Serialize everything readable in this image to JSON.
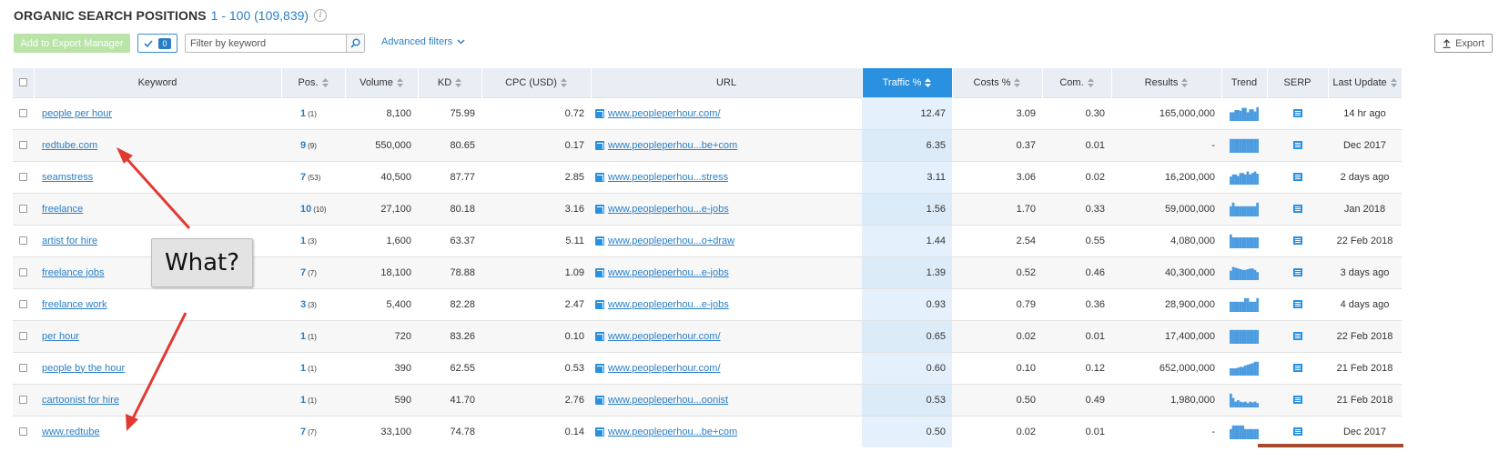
{
  "header": {
    "title": "ORGANIC SEARCH POSITIONS",
    "range": "1 - 100 (109,839)",
    "info_icon": "info-icon"
  },
  "toolbar": {
    "export_manager_label": "Add to Export Manager",
    "selected_count": "0",
    "filter_placeholder": "Filter by keyword",
    "filter_value": "",
    "advanced_filters_label": "Advanced filters",
    "export_label": "Export"
  },
  "columns": [
    {
      "key": "checkbox",
      "label": ""
    },
    {
      "key": "keyword",
      "label": "Keyword"
    },
    {
      "key": "pos",
      "label": "Pos."
    },
    {
      "key": "volume",
      "label": "Volume"
    },
    {
      "key": "kd",
      "label": "KD"
    },
    {
      "key": "cpc",
      "label": "CPC (USD)"
    },
    {
      "key": "url",
      "label": "URL"
    },
    {
      "key": "traffic",
      "label": "Traffic %"
    },
    {
      "key": "costs",
      "label": "Costs %"
    },
    {
      "key": "com",
      "label": "Com."
    },
    {
      "key": "results",
      "label": "Results"
    },
    {
      "key": "trend",
      "label": "Trend"
    },
    {
      "key": "serp",
      "label": "SERP"
    },
    {
      "key": "last_update",
      "label": "Last Update"
    }
  ],
  "active_sort_column": "traffic",
  "rows": [
    {
      "keyword": "people per hour",
      "pos": "1",
      "prev": "(1)",
      "volume": "8,100",
      "kd": "75.99",
      "cpc": "0.72",
      "url": "www.peopleperhour.com/",
      "traffic": "12.47",
      "costs": "3.09",
      "com": "0.30",
      "results": "165,000,000",
      "trend": [
        0.6,
        0.6,
        0.75,
        0.75,
        0.7,
        0.9,
        0.9,
        0.6,
        0.8,
        0.8,
        0.65,
        0.95
      ],
      "last_update": "14 hr ago"
    },
    {
      "keyword": "redtube.com",
      "pos": "9",
      "prev": "(9)",
      "volume": "550,000",
      "kd": "80.65",
      "cpc": "0.17",
      "url": "www.peopleperhou...be+com",
      "traffic": "6.35",
      "costs": "0.37",
      "com": "0.01",
      "results": "-",
      "trend": [
        0.95,
        0.95,
        0.95,
        0.95,
        0.95,
        0.95,
        0.95,
        0.95,
        0.95,
        0.95,
        0.95,
        0.95
      ],
      "last_update": "Dec 2017"
    },
    {
      "keyword": "seamstress",
      "pos": "7",
      "prev": "(53)",
      "volume": "40,500",
      "kd": "87.77",
      "cpc": "2.85",
      "url": "www.peopleperhou...stress",
      "traffic": "3.11",
      "costs": "3.06",
      "com": "0.02",
      "results": "16,200,000",
      "trend": [
        0.55,
        0.7,
        0.7,
        0.6,
        0.8,
        0.8,
        0.7,
        0.9,
        0.7,
        0.8,
        0.9,
        0.75
      ],
      "last_update": "2 days ago"
    },
    {
      "keyword": "freelance",
      "pos": "10",
      "prev": "(10)",
      "volume": "27,100",
      "kd": "80.18",
      "cpc": "3.16",
      "url": "www.peopleperhou...e-jobs",
      "traffic": "1.56",
      "costs": "1.70",
      "com": "0.33",
      "results": "59,000,000",
      "trend": [
        0.7,
        0.95,
        0.7,
        0.7,
        0.7,
        0.7,
        0.7,
        0.7,
        0.7,
        0.7,
        0.7,
        0.95
      ],
      "last_update": "Jan 2018"
    },
    {
      "keyword": "artist for hire",
      "pos": "1",
      "prev": "(3)",
      "volume": "1,600",
      "kd": "63.37",
      "cpc": "5.11",
      "url": "www.peopleperhou...o+draw",
      "traffic": "1.44",
      "costs": "2.54",
      "com": "0.55",
      "results": "4,080,000",
      "trend": [
        0.95,
        0.75,
        0.75,
        0.75,
        0.75,
        0.75,
        0.75,
        0.75,
        0.75,
        0.75,
        0.75,
        0.75
      ],
      "last_update": "22 Feb 2018"
    },
    {
      "keyword": "freelance jobs",
      "pos": "7",
      "prev": "(7)",
      "volume": "18,100",
      "kd": "78.88",
      "cpc": "1.09",
      "url": "www.peopleperhou...e-jobs",
      "traffic": "1.39",
      "costs": "0.52",
      "com": "0.46",
      "results": "40,300,000",
      "trend": [
        0.65,
        0.9,
        0.85,
        0.8,
        0.75,
        0.7,
        0.7,
        0.75,
        0.8,
        0.8,
        0.7,
        0.55
      ],
      "last_update": "3 days ago"
    },
    {
      "keyword": "freelance work",
      "pos": "3",
      "prev": "(3)",
      "volume": "5,400",
      "kd": "82.28",
      "cpc": "2.47",
      "url": "www.peopleperhou...e-jobs",
      "traffic": "0.93",
      "costs": "0.79",
      "com": "0.36",
      "results": "28,900,000",
      "trend": [
        0.7,
        0.7,
        0.7,
        0.7,
        0.7,
        0.7,
        0.95,
        0.95,
        0.7,
        0.7,
        0.7,
        0.95
      ],
      "last_update": "4 days ago"
    },
    {
      "keyword": "per hour",
      "pos": "1",
      "prev": "(1)",
      "volume": "720",
      "kd": "83.26",
      "cpc": "0.10",
      "url": "www.peopleperhour.com/",
      "traffic": "0.65",
      "costs": "0.02",
      "com": "0.01",
      "results": "17,400,000",
      "trend": [
        0.95,
        0.95,
        0.95,
        0.95,
        0.95,
        0.95,
        0.95,
        0.95,
        0.95,
        0.95,
        0.95,
        0.95
      ],
      "last_update": "22 Feb 2018"
    },
    {
      "keyword": "people by the hour",
      "pos": "1",
      "prev": "(1)",
      "volume": "390",
      "kd": "62.55",
      "cpc": "0.53",
      "url": "www.peopleperhour.com/",
      "traffic": "0.60",
      "costs": "0.10",
      "com": "0.12",
      "results": "652,000,000",
      "trend": [
        0.5,
        0.5,
        0.5,
        0.55,
        0.6,
        0.6,
        0.7,
        0.75,
        0.8,
        0.85,
        0.95,
        0.95
      ],
      "last_update": "21 Feb 2018"
    },
    {
      "keyword": "cartoonist for hire",
      "pos": "1",
      "prev": "(1)",
      "volume": "590",
      "kd": "41.70",
      "cpc": "2.76",
      "url": "www.peopleperhou...oonist",
      "traffic": "0.53",
      "costs": "0.50",
      "com": "0.49",
      "results": "1,980,000",
      "trend": [
        0.95,
        0.65,
        0.4,
        0.5,
        0.4,
        0.35,
        0.4,
        0.3,
        0.4,
        0.35,
        0.4,
        0.3
      ],
      "last_update": "21 Feb 2018"
    },
    {
      "keyword": "www.redtube",
      "pos": "7",
      "prev": "(7)",
      "volume": "33,100",
      "kd": "74.78",
      "cpc": "0.14",
      "url": "www.peopleperhou...be+com",
      "traffic": "0.50",
      "costs": "0.02",
      "com": "0.01",
      "results": "-",
      "trend": [
        0.7,
        0.95,
        0.95,
        0.95,
        0.95,
        0.95,
        0.7,
        0.7,
        0.7,
        0.7,
        0.7,
        0.7
      ],
      "last_update": "Dec 2017"
    }
  ],
  "annotation": {
    "callout_text": "What?",
    "arrow_color": "#e03a32"
  },
  "colors": {
    "accent": "#2a7ec6",
    "active_header": "#2a90e0",
    "traffic_column": "#e4f1fc",
    "export_button": "#b9e3a8",
    "trend_bars": "#4b9be0"
  }
}
